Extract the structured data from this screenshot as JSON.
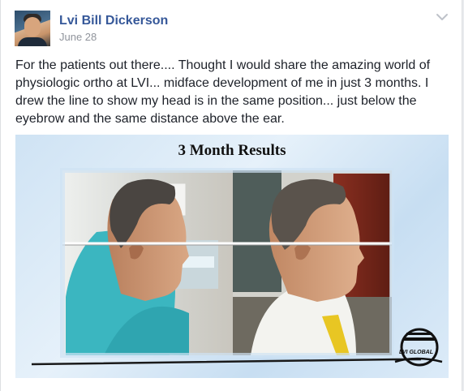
{
  "post": {
    "author": "Lvi Bill Dickerson",
    "date": "June 28",
    "text": "For the patients out there.... Thought I would share the amazing world of physiologic ortho at LVI... midface development of me in just 3 months. I drew the line to show my head is in the same position... just below the eyebrow and the same distance above the ear."
  },
  "image": {
    "title": "3 Month Results",
    "logo_text": "LVI GLOBAL"
  },
  "icons": {
    "menu": "chevron-down-icon",
    "avatar": "profile-photo"
  }
}
